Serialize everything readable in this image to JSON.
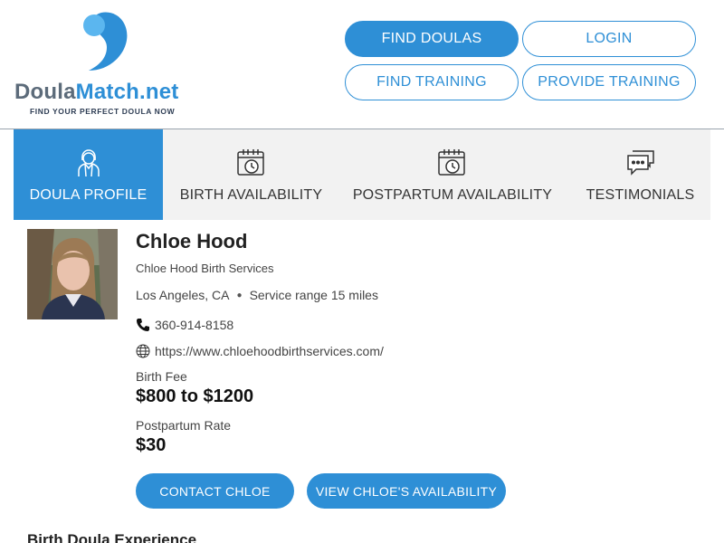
{
  "brand": {
    "name_part1": "Doula",
    "name_part2": "Match.net",
    "tagline": "FIND YOUR PERFECT DOULA NOW",
    "colors": {
      "primary": "#2e8fd6",
      "logo_dark": "#5c6b7a",
      "tab_bg": "#f2f2f2"
    }
  },
  "nav": {
    "find_doulas": "FIND DOULAS",
    "login": "LOGIN",
    "find_training": "FIND TRAINING",
    "provide_training": "PROVIDE TRAINING"
  },
  "tabs": [
    {
      "label": "DOULA PROFILE",
      "icon": "doula-person-icon",
      "active": true
    },
    {
      "label": "BIRTH AVAILABILITY",
      "icon": "calendar-clock-icon",
      "active": false
    },
    {
      "label": "POSTPARTUM AVAILABILITY",
      "icon": "calendar-clock-icon",
      "active": false
    },
    {
      "label": "TESTIMONIALS",
      "icon": "chat-bubbles-icon",
      "active": false
    }
  ],
  "profile": {
    "name": "Chloe Hood",
    "business": "Chloe Hood Birth Services",
    "city": "Los Angeles, CA",
    "service_range": "Service range 15 miles",
    "phone": "360-914-8158",
    "website": "https://www.chloehoodbirthservices.com/",
    "birth_fee_label": "Birth Fee",
    "birth_fee": "$800 to $1200",
    "postpartum_label": "Postpartum Rate",
    "postpartum_rate": "$30",
    "contact_button": "CONTACT CHLOE",
    "availability_button": "VIEW CHLOE'S AVAILABILITY"
  },
  "sections": {
    "experience_title": "Birth Doula Experience"
  }
}
